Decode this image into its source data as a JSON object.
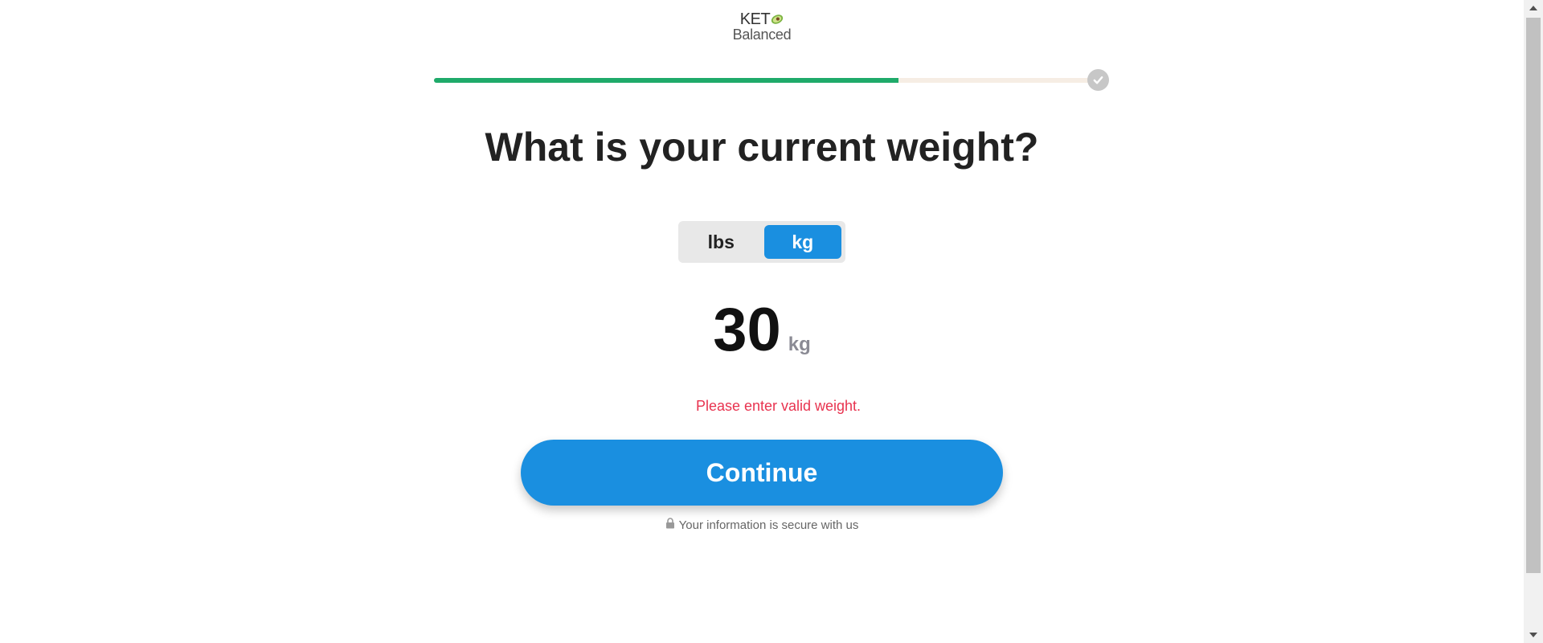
{
  "logo": {
    "top_text": "KET",
    "bottom_text": "Balanced",
    "avocado_color": "#7cb342"
  },
  "progress": {
    "fraction": 0.7,
    "fill_color": "#1faa6a",
    "track_color": "#f6ede4",
    "end_icon": "check-icon"
  },
  "question": {
    "title": "What is your current weight?"
  },
  "unit_toggle": {
    "options": [
      {
        "label": "lbs",
        "selected": false
      },
      {
        "label": "kg",
        "selected": true
      }
    ],
    "accent_color": "#1a8fe0"
  },
  "weight": {
    "value": "30",
    "unit": "kg"
  },
  "error": {
    "message": "Please enter valid weight.",
    "color": "#e8334f"
  },
  "continue_button": {
    "label": "Continue",
    "color": "#1a8fe0"
  },
  "secure_note": {
    "icon": "lock-icon",
    "text": "Your information is secure with us"
  }
}
